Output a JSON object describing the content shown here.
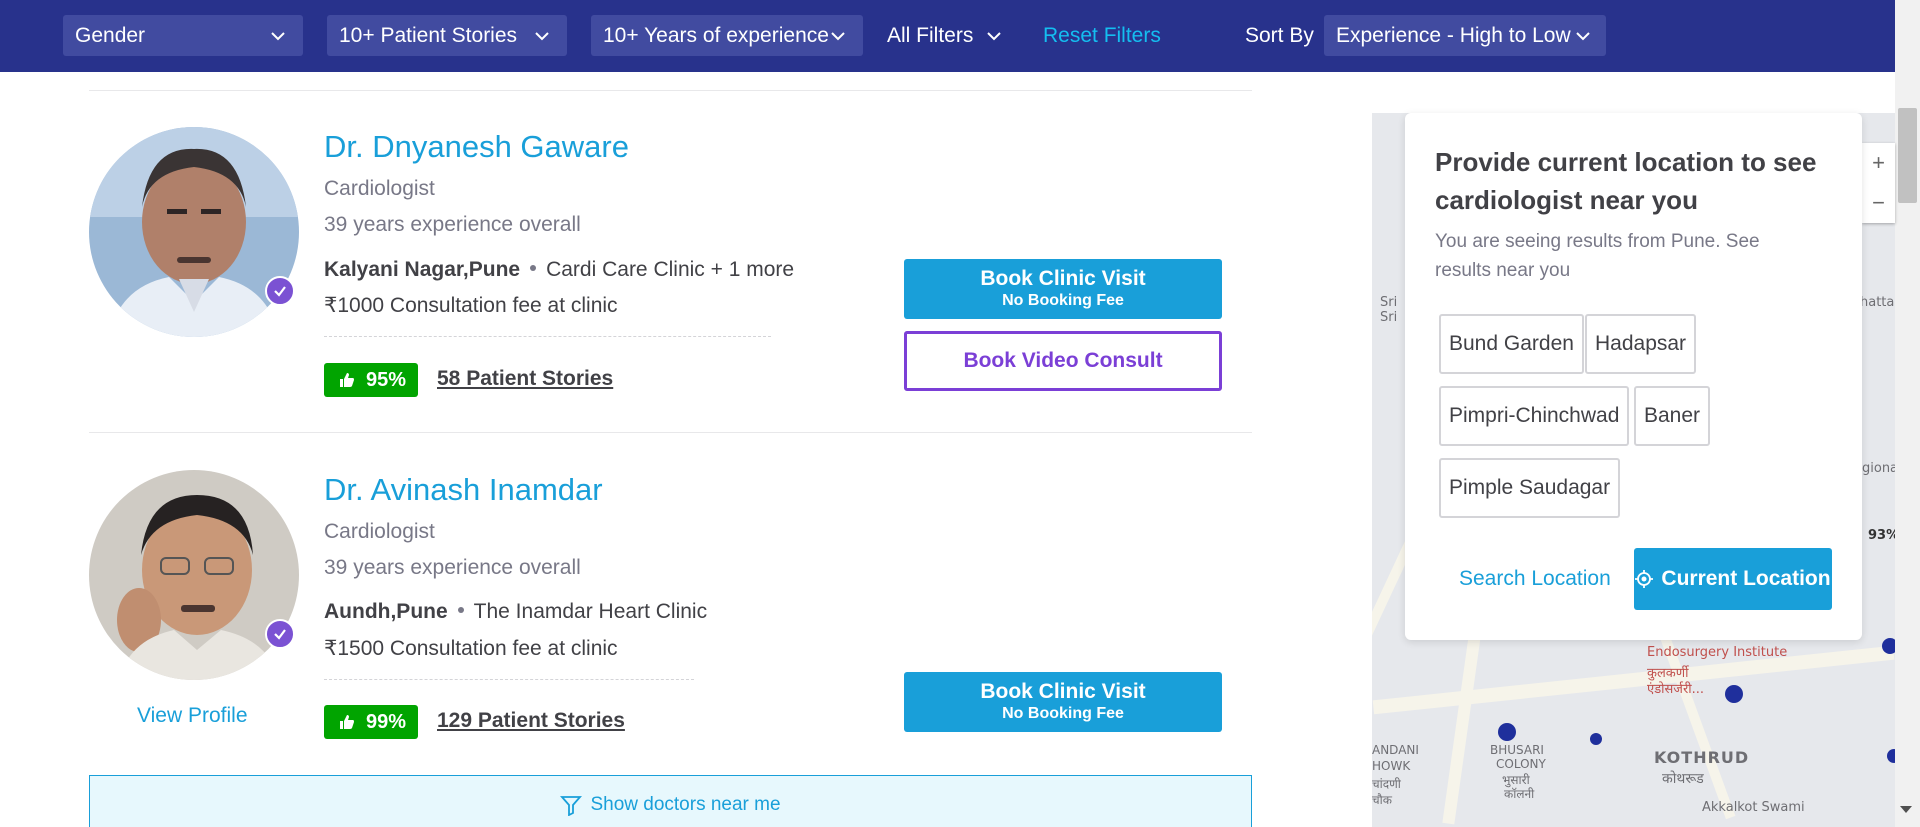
{
  "filters": {
    "gender": "Gender",
    "stories": "10+ Patient Stories",
    "experience": "10+ Years of experience",
    "all_filters": "All Filters",
    "reset": "Reset Filters",
    "sort_label": "Sort By",
    "sort_value": "Experience - High to Low"
  },
  "doctors": [
    {
      "name": "Dr. Dnyanesh Gaware",
      "specialty": "Cardiologist",
      "experience": "39 years experience overall",
      "area": "Kalyani Nagar,Pune",
      "clinic": "Cardi Care Clinic + 1 more",
      "fee": "₹1000 Consultation fee at clinic",
      "rating": "95%",
      "stories": "58 Patient Stories",
      "clinic_btn": "Book Clinic Visit",
      "clinic_btn_sub": "No Booking Fee",
      "video_btn": "Book Video Consult"
    },
    {
      "name": "Dr. Avinash Inamdar",
      "specialty": "Cardiologist",
      "experience": "39 years experience overall",
      "area": "Aundh,Pune",
      "clinic": "The Inamdar Heart Clinic",
      "fee": "₹1500 Consultation fee at clinic",
      "rating": "99%",
      "stories": "129 Patient Stories",
      "clinic_btn": "Book Clinic Visit",
      "clinic_btn_sub": "No Booking Fee",
      "view_profile": "View Profile"
    }
  ],
  "near_me": "Show doctors near me",
  "location_popup": {
    "title": "Provide current location to see cardiologist near you",
    "subtitle": "You are seeing results from Pune. See results near you",
    "chips": [
      "Bund Garden",
      "Hadapsar",
      "Pimpri-Chinchwad",
      "Baner",
      "Pimple Saudagar"
    ],
    "search": "Search Location",
    "current": "Current Location"
  },
  "map": {
    "zoom_in": "+",
    "zoom_out": "−",
    "labels": [
      "Endosurgery Institute",
      "कुलकर्णी",
      "एंडोसर्जरी...",
      "KOTHRUD",
      "कोथरूड",
      "BHUSARI",
      "COLONY",
      "भुसारी",
      "कॉलनी",
      "ANDANI",
      "HOWK",
      "चांदणी",
      "चौक",
      "Akkalkot Swami",
      "Sri",
      "Sri",
      "hatta",
      "gional",
      "93%"
    ]
  },
  "colors": {
    "header_bg": "#28328c",
    "accent": "#199fd9",
    "video": "#7b3fd6",
    "rating": "#01a400"
  }
}
